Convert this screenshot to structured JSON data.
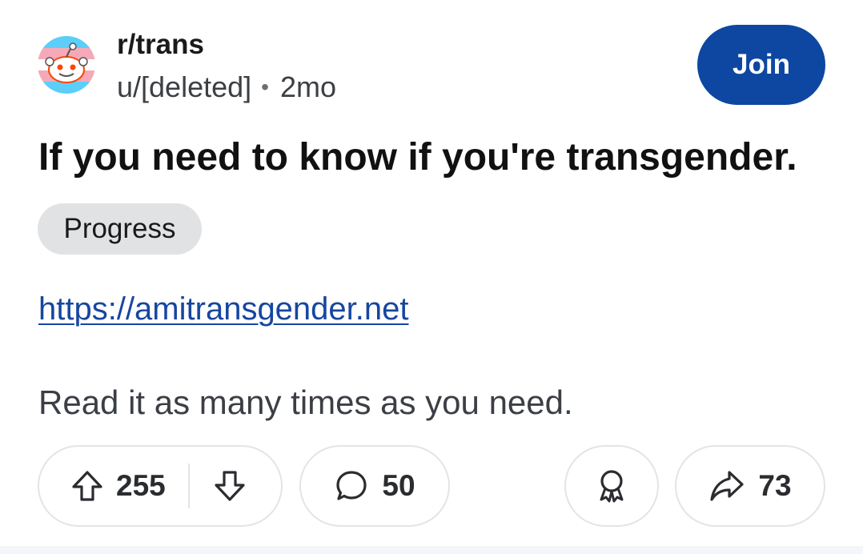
{
  "post": {
    "subreddit": "r/trans",
    "author": "u/[deleted]",
    "separator": "•",
    "age": "2mo",
    "join_label": "Join",
    "title": "If you need to know if you're transgender.",
    "flair": "Progress",
    "link_text": "https://amitransgender.net",
    "body": "Read it as many times as you need."
  },
  "actions": {
    "upvotes": "255",
    "comments": "50",
    "shares": "73"
  },
  "icons": {
    "avatar": "trans-flag-snoo-icon",
    "upvote": "upvote-arrow-icon",
    "downvote": "downvote-arrow-icon",
    "comment": "comment-bubble-icon",
    "award": "award-ribbon-icon",
    "share": "share-arrow-icon"
  },
  "colors": {
    "join_button": "#0d47a1",
    "link": "#1646a0",
    "flair_bg": "#e1e2e3",
    "flag_blue": "#5bcefa",
    "flag_pink": "#f5a9b8",
    "snoo_orange": "#ff4500"
  }
}
